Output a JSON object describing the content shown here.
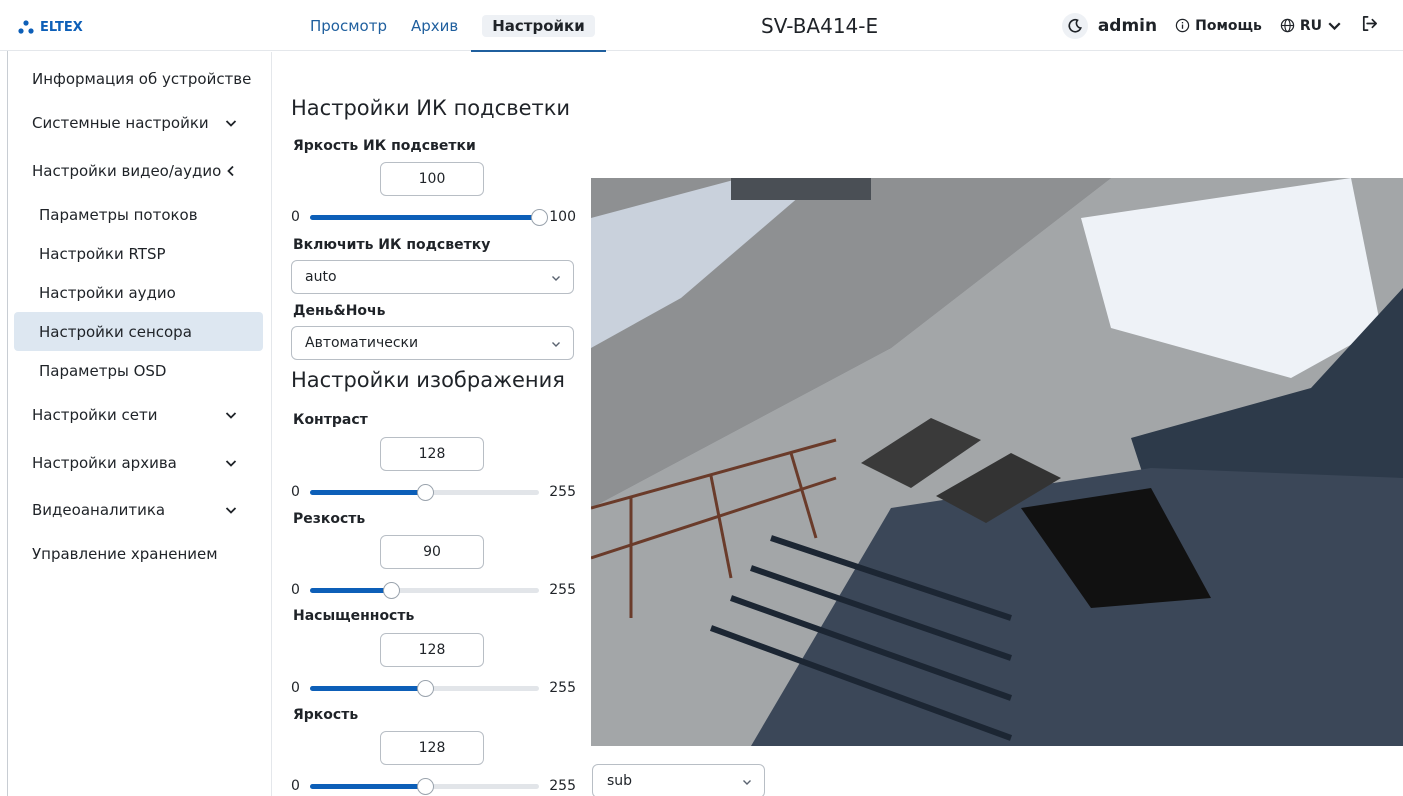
{
  "brand": {
    "logo_text": "ELTEX",
    "accent": "#0d5fb8"
  },
  "tabs": [
    {
      "label": "Просмотр",
      "active": false
    },
    {
      "label": "Архив",
      "active": false
    },
    {
      "label": "Настройки",
      "active": true
    }
  ],
  "device_title": "SV-BA414-E",
  "header": {
    "theme_icon": "moon-icon",
    "user": "admin",
    "help_label": "Помощь",
    "lang_label": "RU",
    "logout_icon": "logout-icon"
  },
  "sidebar": {
    "items": [
      {
        "label": "Информация об устройстве",
        "chevron": "none"
      },
      {
        "label": "Системные настройки",
        "chevron": "down"
      },
      {
        "label": "Настройки видео/аудио",
        "chevron": "left"
      },
      {
        "label": "Параметры потоков",
        "sub": true
      },
      {
        "label": "Настройки RTSP",
        "sub": true
      },
      {
        "label": "Настройки аудио",
        "sub": true
      },
      {
        "label": "Настройки сенсора",
        "sub": true,
        "active": true
      },
      {
        "label": "Параметры OSD",
        "sub": true
      },
      {
        "label": "Настройки сети",
        "chevron": "down"
      },
      {
        "label": "Настройки архива",
        "chevron": "down"
      },
      {
        "label": "Видеоаналитика",
        "chevron": "down"
      },
      {
        "label": "Управление хранением",
        "chevron": "none"
      }
    ]
  },
  "ir": {
    "section_title": "Настройки ИК подсветки",
    "brightness": {
      "label": "Яркость ИК подсветки",
      "value": "100",
      "min": "0",
      "max": "100",
      "level": 100
    },
    "enable": {
      "label": "Включить ИК подсветку",
      "selected": "auto"
    },
    "daynight": {
      "label": "День&Ночь",
      "selected": "Автоматически"
    }
  },
  "image": {
    "section_title": "Настройки изображения",
    "contrast": {
      "label": "Контраст",
      "value": "128",
      "min": "0",
      "max": "255",
      "level": 128
    },
    "sharpness": {
      "label": "Резкость",
      "value": "90",
      "min": "0",
      "max": "255",
      "level": 90
    },
    "saturation": {
      "label": "Насыщенность",
      "value": "128",
      "min": "0",
      "max": "255",
      "level": 128
    },
    "brightness": {
      "label": "Яркость",
      "value": "128",
      "min": "0",
      "max": "255",
      "level": 128
    }
  },
  "video": {
    "stream_selected": "sub"
  }
}
